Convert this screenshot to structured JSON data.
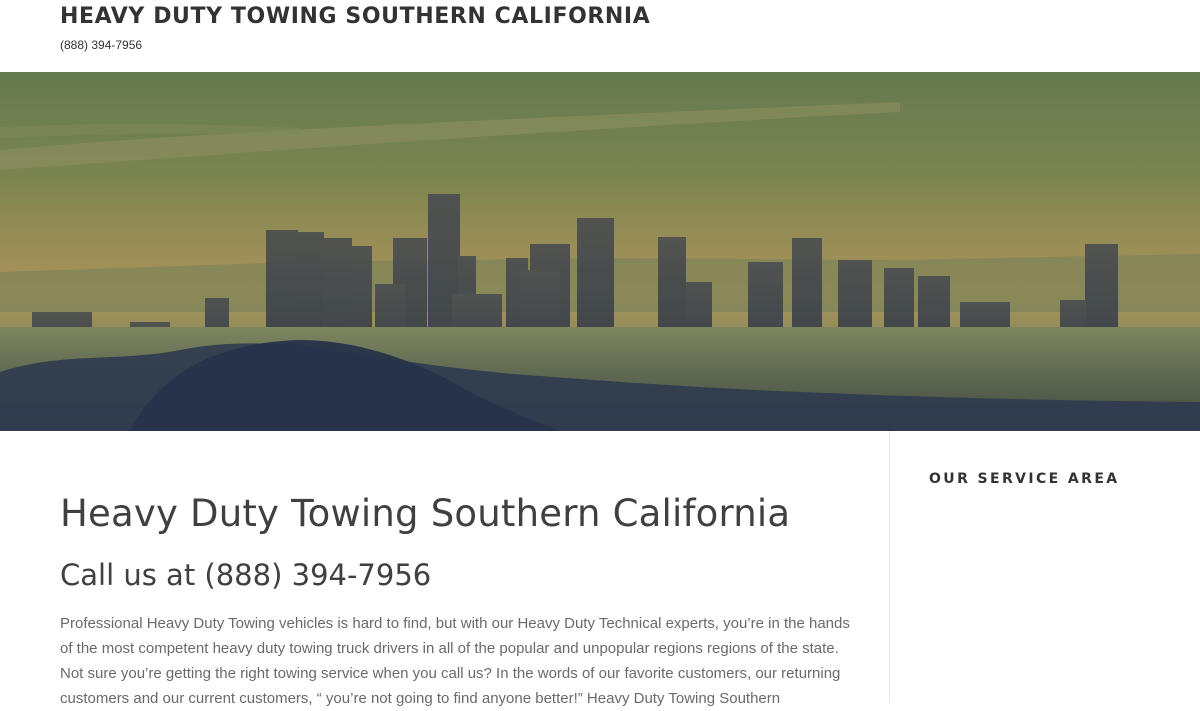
{
  "header": {
    "site_title": "HEAVY DUTY TOWING SOUTHERN CALIFORNIA",
    "phone": "(888) 394-7956"
  },
  "hero": {
    "image_description_icon": "city-skyline-image",
    "tint_colors": {
      "sky": "#6b7d4e",
      "haze": "#a38c55",
      "shadow": "#2e3a52"
    }
  },
  "main": {
    "heading": "Heavy Duty Towing Southern California",
    "subheading": "Call us at (888) 394-7956",
    "paragraph": "Professional Heavy Duty Towing vehicles is hard to find, but with our Heavy Duty Technical experts, you’re in the hands of the most competent heavy duty towing truck drivers in all of the popular and unpopular regions regions of the state. Not sure you’re getting the right towing service when you call us? In the words of our favorite customers, our returning customers and our current customers, “ you’re not going to find anyone better!” Heavy Duty Towing Southern"
  },
  "sidebar": {
    "widget_title": "OUR SERVICE AREA"
  }
}
